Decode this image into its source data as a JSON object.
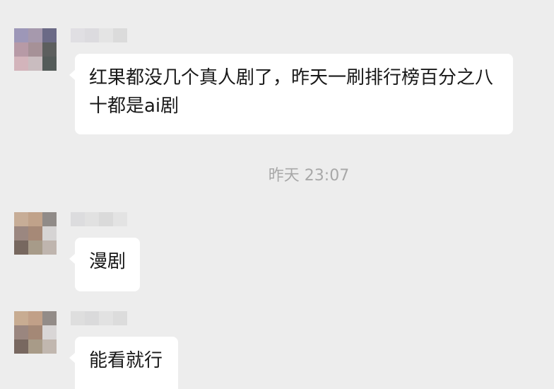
{
  "messages": [
    {
      "text": "红果都没几个真人剧了，昨天一刷排行榜百分之八十都是ai剧"
    },
    {
      "text": "漫剧"
    },
    {
      "text": "能看就行"
    }
  ],
  "timestamp": "昨天 23:07",
  "colors": {
    "background": "#ededed",
    "bubble": "#ffffff",
    "text": "#191919",
    "timestamp": "#a8a8a8"
  },
  "avatar1_colors": [
    "#9d97b8",
    "#a699ad",
    "#6b6a86",
    "#b79aa6",
    "#a69197",
    "#5d5f5e",
    "#d3b4bb",
    "#c9bcbf",
    "#545b59"
  ],
  "avatar2_colors": [
    "#c7ad97",
    "#c0a28a",
    "#908b88",
    "#9b8780",
    "#a68977",
    "#d6d4d4",
    "#77685f",
    "#a79b89",
    "#bfb5ae"
  ],
  "avatar3_colors": [
    "#c8ac92",
    "#c1a088",
    "#938c88",
    "#9a867f",
    "#a48876",
    "#d9d6d6",
    "#786860",
    "#a89b88",
    "#c1b7af"
  ],
  "nickname1_colors": [
    "#e0dfe3",
    "#dcdbdf",
    "#e4e4e4",
    "#dbdbdb"
  ],
  "nickname2_colors": [
    "#dcdcde",
    "#e1e1e1",
    "#dadada",
    "#e3e3e3"
  ],
  "nickname3_colors": [
    "#dedede",
    "#dadadb",
    "#e2e2e2",
    "#dcdcdc"
  ]
}
